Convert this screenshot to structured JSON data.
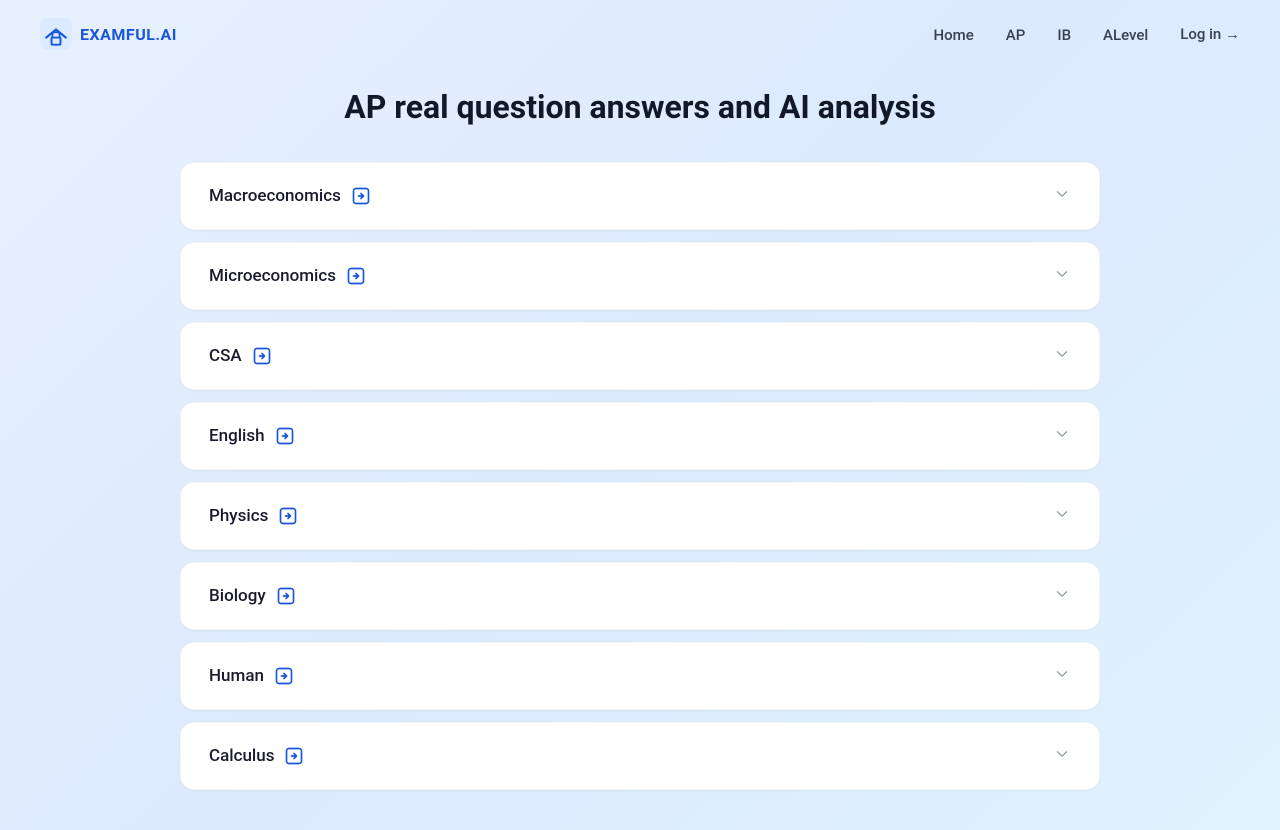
{
  "site": {
    "logo_text": "EXAMFUL.AI",
    "title": "AP real question answers and AI analysis"
  },
  "nav": {
    "links": [
      {
        "id": "home",
        "label": "Home",
        "href": "#"
      },
      {
        "id": "ap",
        "label": "AP",
        "href": "#"
      },
      {
        "id": "ib",
        "label": "IB",
        "href": "#"
      },
      {
        "id": "alevel",
        "label": "ALevel",
        "href": "#"
      }
    ],
    "login_label": "Log in →"
  },
  "accordion": {
    "items": [
      {
        "id": "macroeconomics",
        "label": "Macroeconomics"
      },
      {
        "id": "microeconomics",
        "label": "Microeconomics"
      },
      {
        "id": "csa",
        "label": "CSA"
      },
      {
        "id": "english",
        "label": "English"
      },
      {
        "id": "physics",
        "label": "Physics"
      },
      {
        "id": "biology",
        "label": "Biology"
      },
      {
        "id": "human",
        "label": "Human"
      },
      {
        "id": "calculus",
        "label": "Calculus"
      }
    ]
  }
}
